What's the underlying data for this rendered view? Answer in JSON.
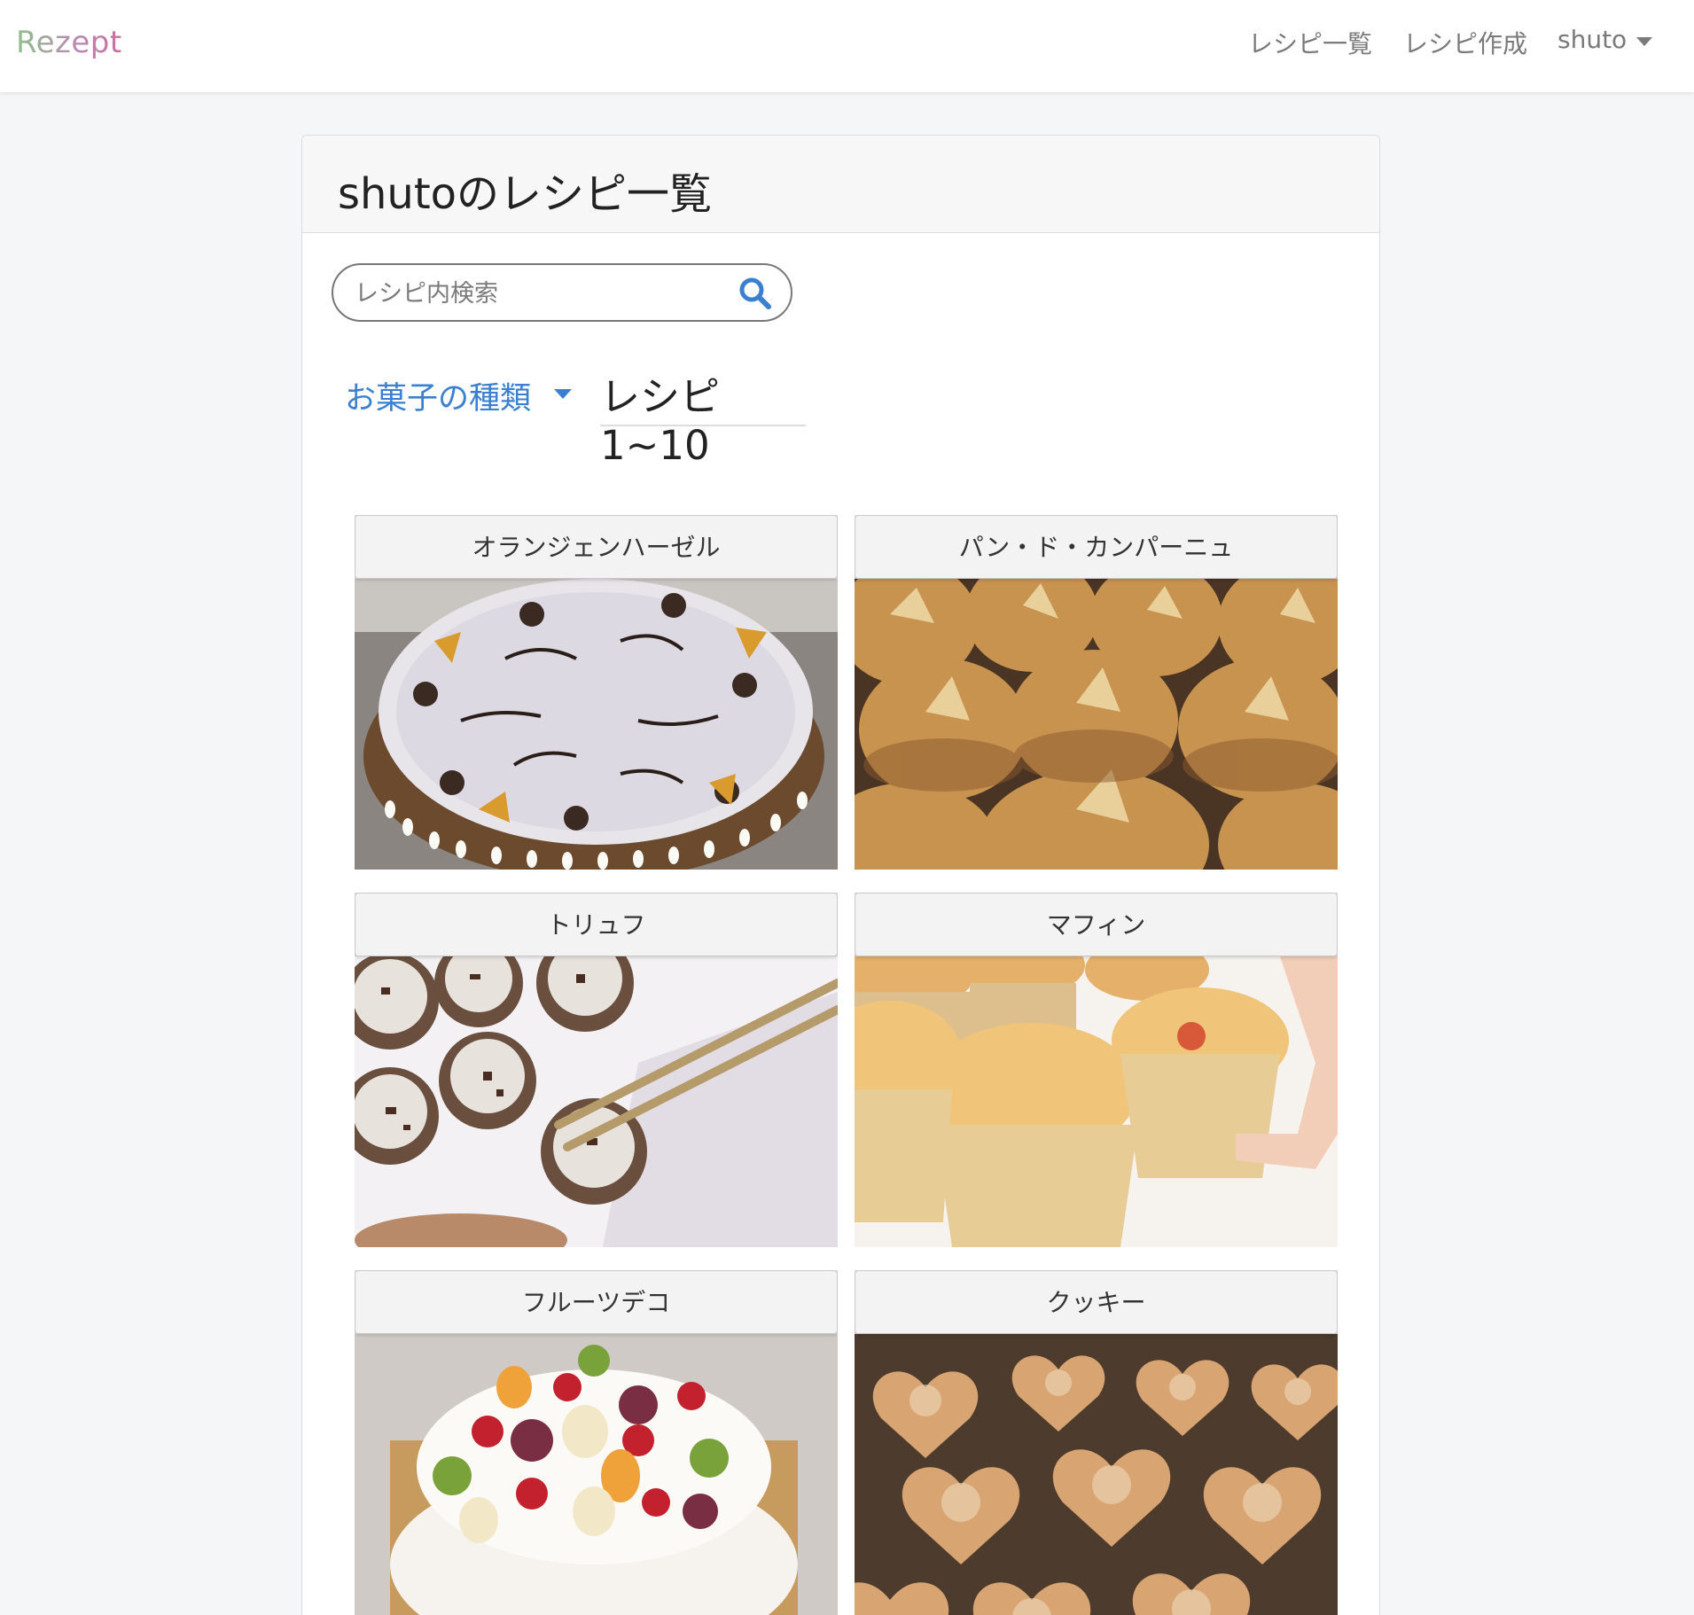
{
  "navbar": {
    "brand": "Rezept",
    "links": {
      "recipe_list": "レシピ一覧",
      "create_recipe": "レシピ作成",
      "user": "shuto"
    },
    "brand_gradient": [
      "#8fc18a",
      "#b88bb0",
      "#d06aa0"
    ]
  },
  "page": {
    "title": "shutoのレシピ一覧",
    "search": {
      "placeholder": "レシピ内検索",
      "icon": "search-icon"
    },
    "category_dropdown": "お菓子の種類",
    "range": "レシピ1~10",
    "accent_color": "#3a7fd0"
  },
  "recipes": [
    {
      "name": "オランジェンハーゼル"
    },
    {
      "name": "パン・ド・カンパーニュ"
    },
    {
      "name": "トリュフ"
    },
    {
      "name": "マフィン"
    },
    {
      "name": "フルーツデコ"
    },
    {
      "name": "クッキー"
    }
  ]
}
